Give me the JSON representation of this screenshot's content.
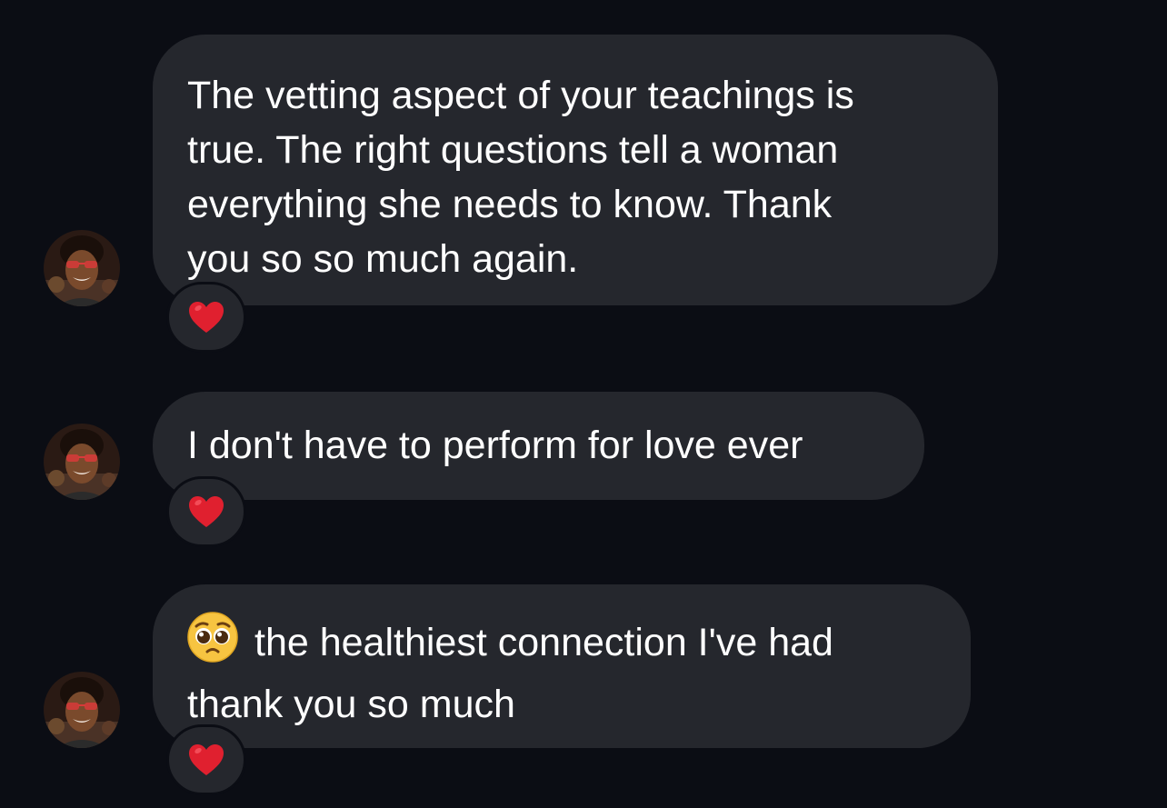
{
  "messages": [
    {
      "lines": [
        "The vetting aspect of your teachings is",
        "true. The right questions tell a woman",
        "everything she needs to know. Thank",
        "you so so much again."
      ],
      "reaction": "red-heart"
    },
    {
      "lines": [
        "I don't have to perform for love ever"
      ],
      "reaction": "red-heart"
    },
    {
      "emoji": "pleading-face",
      "lines": [
        "the healthiest connection I've had",
        "thank you so much"
      ],
      "reaction": "red-heart"
    }
  ],
  "colors": {
    "background": "#0b0d14",
    "bubble": "#25272d",
    "text": "#ffffff",
    "heart": "#e0202f"
  }
}
